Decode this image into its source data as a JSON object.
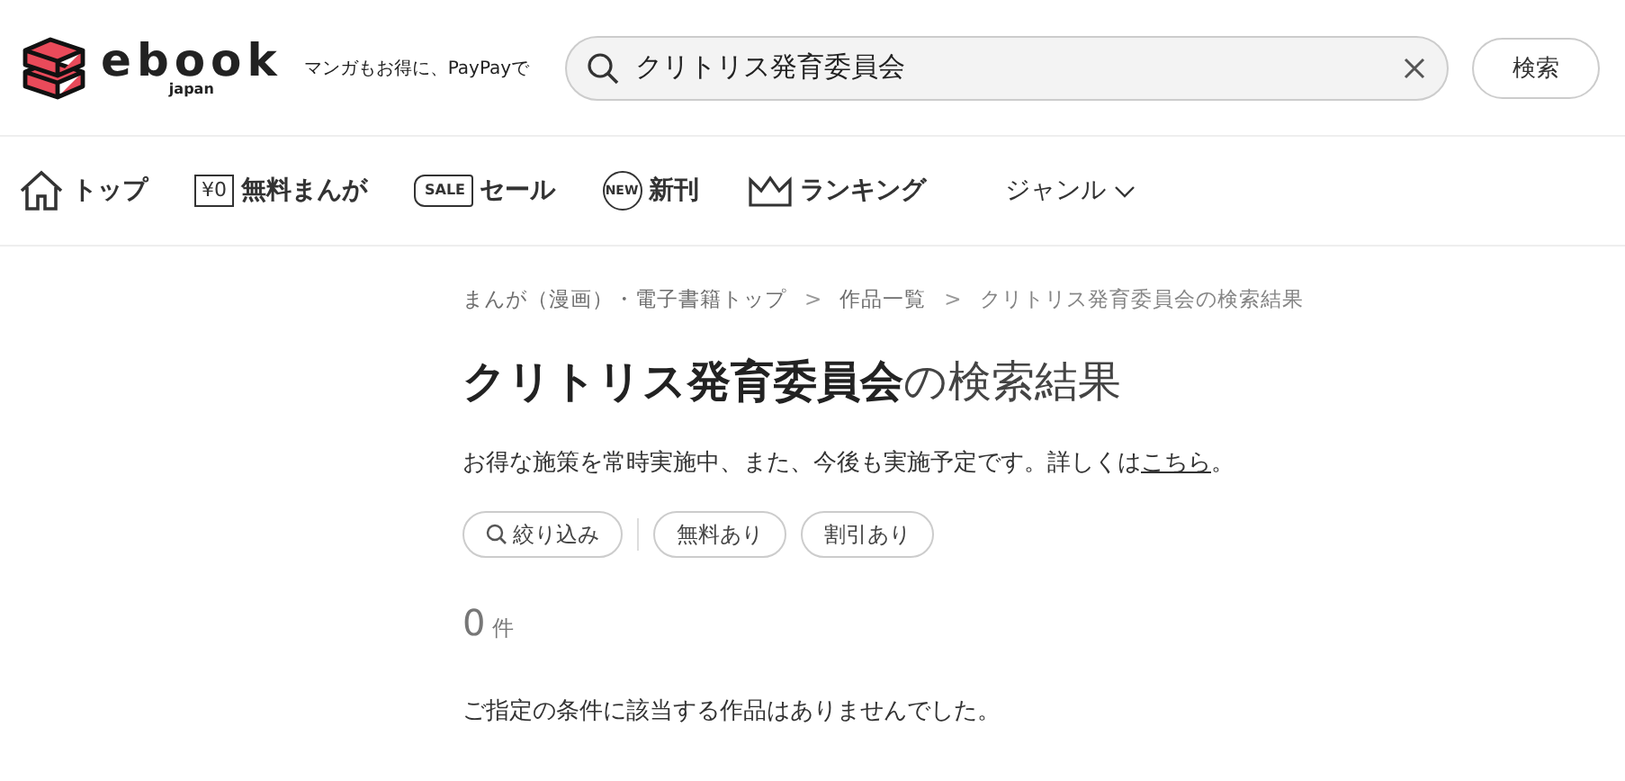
{
  "header": {
    "logo": {
      "word": "ebook",
      "sub": "japan"
    },
    "tagline": "マンガもお得に、PayPayで",
    "search": {
      "value": "クリトリス発育委員会"
    },
    "search_button": "検索"
  },
  "nav": [
    {
      "kind": "home",
      "label": "トップ"
    },
    {
      "kind": "boxed",
      "icon_text": "¥0",
      "label": "無料まんが"
    },
    {
      "kind": "tag",
      "icon_text": "SALE",
      "label": "セール"
    },
    {
      "kind": "bubble",
      "icon_text": "NEW",
      "label": "新刊"
    },
    {
      "kind": "crown",
      "label": "ランキング"
    },
    {
      "kind": "dropdown",
      "label": "ジャンル"
    }
  ],
  "breadcrumbs": [
    {
      "kind": "link",
      "text": "まんが（漫画）・電子書籍トップ"
    },
    {
      "kind": "separator",
      "text": ">"
    },
    {
      "kind": "link",
      "text": "作品一覧"
    },
    {
      "kind": "separator",
      "text": ">"
    },
    {
      "kind": "current",
      "text": "クリトリス発育委員会の検索結果"
    }
  ],
  "heading": "**クリトリス発育委員会**の検索結果",
  "notice": {
    "text": "お得な施策を常時実施中、また、今後も実施予定です。詳しくは",
    "link": "こちら",
    "end": "。"
  },
  "filters": [
    {
      "kind": "search",
      "label": "絞り込み"
    },
    {
      "kind": "toggle",
      "label": "無料あり"
    },
    {
      "kind": "toggle",
      "label": "割引あり"
    }
  ],
  "count": {
    "number": "0",
    "unit": "件"
  },
  "empty_message": "ご指定の条件に該当する作品はありませんでした。"
}
